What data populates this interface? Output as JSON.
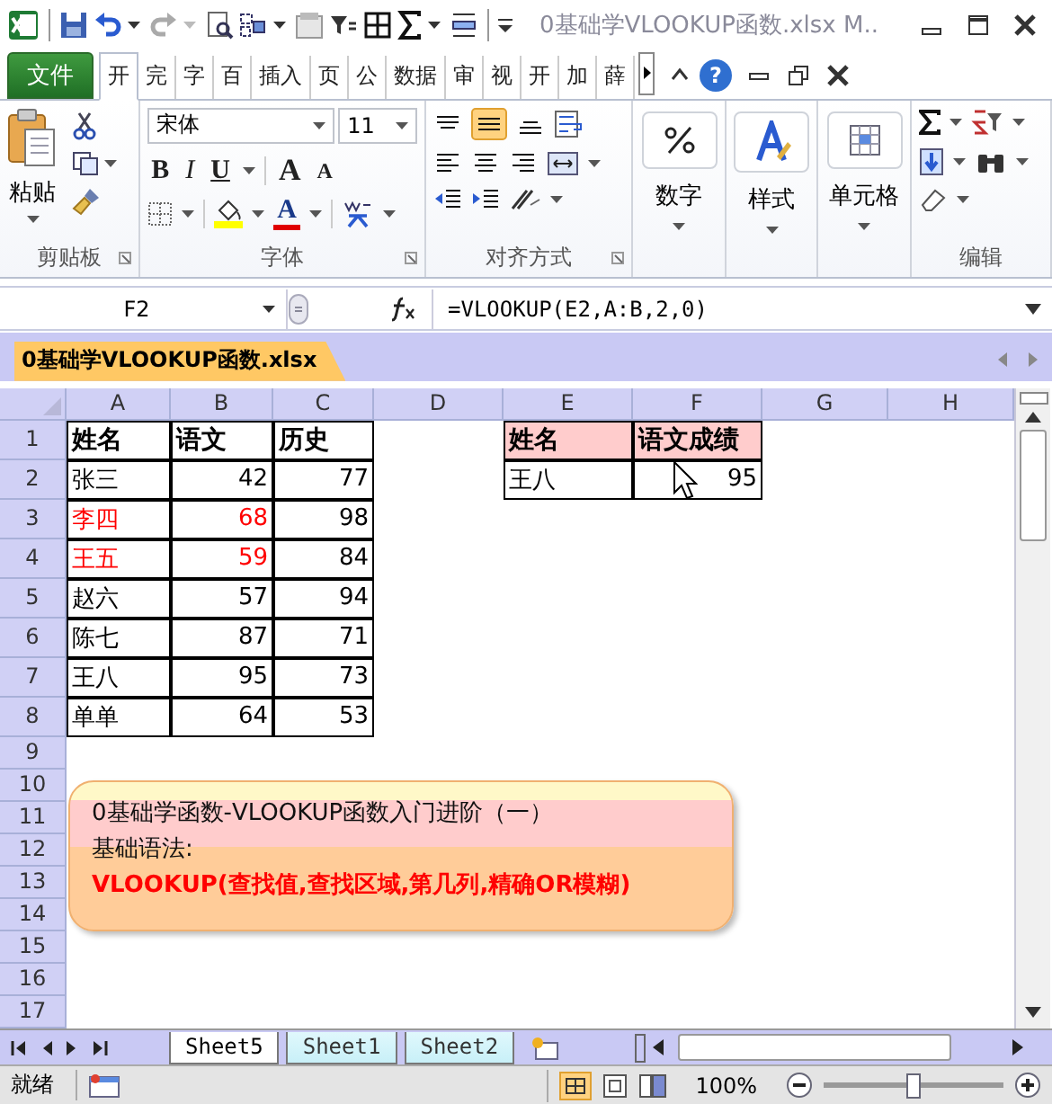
{
  "title_bar": {
    "title": "0基础学VLOOKUP函数.xlsx M.."
  },
  "ribbon_tabs": [
    {
      "label": "文件",
      "kind": "file"
    },
    {
      "label": "开",
      "kind": "tab",
      "selected": true
    },
    {
      "label": "完",
      "kind": "tab",
      "selected": false
    },
    {
      "label": "字",
      "kind": "tab",
      "selected": false
    },
    {
      "label": "百",
      "kind": "tab",
      "selected": false
    },
    {
      "label": "插入",
      "kind": "tab",
      "selected": false
    },
    {
      "label": "页",
      "kind": "tab",
      "selected": false
    },
    {
      "label": "公",
      "kind": "tab",
      "selected": false
    },
    {
      "label": "数据",
      "kind": "tab",
      "selected": false
    },
    {
      "label": "审",
      "kind": "tab",
      "selected": false
    },
    {
      "label": "视",
      "kind": "tab",
      "selected": false
    },
    {
      "label": "开",
      "kind": "tab",
      "selected": false
    },
    {
      "label": "加",
      "kind": "tab",
      "selected": false
    },
    {
      "label": "薛",
      "kind": "tab",
      "selected": false
    }
  ],
  "help": "?",
  "ribbon": {
    "paste": "粘贴",
    "clipboard_label": "剪贴板",
    "font_name": "宋体",
    "font_size": "11",
    "bold": "B",
    "italic": "I",
    "underline": "U",
    "grow_font": "A",
    "shrink_font": "A",
    "font_color": "A",
    "font_label": "字体",
    "align_label": "对齐方式",
    "number": "数字",
    "styles": "样式",
    "cells": "单元格",
    "editing_label": "编辑"
  },
  "formula_bar": {
    "name_box": "F2",
    "formula": "=VLOOKUP(E2,A:B,2,0)"
  },
  "workbook_tab": "0基础学VLOOKUP函数.xlsx",
  "sheet": {
    "columns": [
      "A",
      "B",
      "C",
      "D",
      "E",
      "F",
      "G",
      "H"
    ],
    "rows": [
      "1",
      "2",
      "3",
      "4",
      "5",
      "6",
      "7",
      "8",
      "9",
      "10",
      "11",
      "12",
      "13",
      "14",
      "15",
      "16",
      "17"
    ],
    "score_table": {
      "header": [
        "姓名",
        "语文",
        "历史"
      ],
      "rows": [
        {
          "name": "张三",
          "chinese": "42",
          "history": "77",
          "color": "#000000"
        },
        {
          "name": "李四",
          "chinese": "68",
          "history": "98",
          "color": "#ff0000"
        },
        {
          "name": "王五",
          "chinese": "59",
          "history": "84",
          "color": "#ff0000"
        },
        {
          "name": "赵六",
          "chinese": "57",
          "history": "94",
          "color": "#000000"
        },
        {
          "name": "陈七",
          "chinese": "87",
          "history": "71",
          "color": "#000000"
        },
        {
          "name": "王八",
          "chinese": "95",
          "history": "73",
          "color": "#000000"
        },
        {
          "name": "单单",
          "chinese": "64",
          "history": "53",
          "color": "#000000"
        }
      ]
    },
    "lookup_table": {
      "header": [
        "姓名",
        "语文成绩"
      ],
      "rows": [
        {
          "name": "王八",
          "score": "95"
        }
      ]
    },
    "note": {
      "title": "0基础学函数-VLOOKUP函数入门进阶（一）",
      "subtitle": "基础语法:",
      "syntax": "VLOOKUP(查找值,查找区域,第几列,精确OR模糊)"
    }
  },
  "sheet_tabs": [
    {
      "label": "Sheet5",
      "selected": true
    },
    {
      "label": "Sheet1",
      "selected": false
    },
    {
      "label": "Sheet2",
      "selected": false
    }
  ],
  "status_bar": {
    "status": "就绪",
    "zoom": "100%",
    "zoom_slider": {
      "level": 0.5
    }
  }
}
